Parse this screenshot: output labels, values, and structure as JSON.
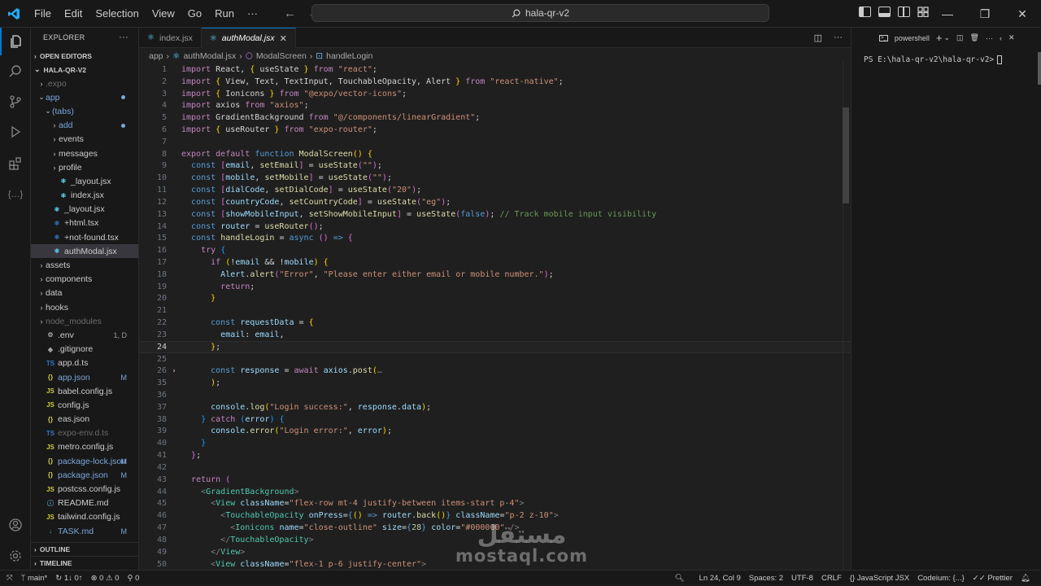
{
  "titlebar": {
    "menu": [
      "File",
      "Edit",
      "Selection",
      "View",
      "Go",
      "Run",
      "···"
    ],
    "search": "hala-qr-v2"
  },
  "sidebar": {
    "title": "EXPLORER",
    "more": "···",
    "open_editors": "OPEN EDITORS",
    "project": "HALA-QR-V2",
    "items": [
      {
        "label": ".expo",
        "type": "folder",
        "indent": 1,
        "state": "collapsed",
        "dim": true,
        "icon": "folder"
      },
      {
        "label": "app",
        "type": "folder",
        "indent": 1,
        "state": "expanded",
        "mod": true,
        "badge": "dot",
        "icon": "folder"
      },
      {
        "label": "(tabs)",
        "type": "folder",
        "indent": 2,
        "state": "expanded",
        "mod": true,
        "icon": "folder"
      },
      {
        "label": "add",
        "type": "folder",
        "indent": 3,
        "state": "collapsed",
        "mod": true,
        "badge": "dot",
        "icon": "folder"
      },
      {
        "label": "events",
        "type": "folder",
        "indent": 3,
        "state": "collapsed",
        "icon": "folder"
      },
      {
        "label": "messages",
        "type": "folder",
        "indent": 3,
        "state": "collapsed",
        "icon": "folder"
      },
      {
        "label": "profile",
        "type": "folder",
        "indent": 3,
        "state": "collapsed",
        "icon": "folder"
      },
      {
        "label": "_layout.jsx",
        "type": "file",
        "indent": 3,
        "icon": "react",
        "icon_color": "#61dafb"
      },
      {
        "label": "index.jsx",
        "type": "file",
        "indent": 3,
        "icon": "react",
        "icon_color": "#61dafb"
      },
      {
        "label": "_layout.jsx",
        "type": "file",
        "indent": 2,
        "icon": "react",
        "icon_color": "#61dafb"
      },
      {
        "label": "+html.tsx",
        "type": "file",
        "indent": 2,
        "icon": "react-ts",
        "icon_color": "#3178c6"
      },
      {
        "label": "+not-found.tsx",
        "type": "file",
        "indent": 2,
        "icon": "react-ts",
        "icon_color": "#3178c6"
      },
      {
        "label": "authModal.jsx",
        "type": "file",
        "indent": 2,
        "icon": "react",
        "icon_color": "#61dafb",
        "selected": true
      },
      {
        "label": "assets",
        "type": "folder",
        "indent": 1,
        "state": "collapsed",
        "icon": "folder"
      },
      {
        "label": "components",
        "type": "folder",
        "indent": 1,
        "state": "collapsed",
        "icon": "folder"
      },
      {
        "label": "data",
        "type": "folder",
        "indent": 1,
        "state": "collapsed",
        "icon": "folder"
      },
      {
        "label": "hooks",
        "type": "folder",
        "indent": 1,
        "state": "collapsed",
        "icon": "folder"
      },
      {
        "label": "node_modules",
        "type": "folder",
        "indent": 1,
        "state": "collapsed",
        "dim": true,
        "icon": "folder"
      },
      {
        "label": ".env",
        "type": "file",
        "indent": 1,
        "icon": "gear",
        "icon_color": "#a0a0a0",
        "badge_text": "1, D",
        "badge_gray": true
      },
      {
        "label": ".gitignore",
        "type": "file",
        "indent": 1,
        "icon": "git",
        "icon_color": "#a0a0a0"
      },
      {
        "label": "app.d.ts",
        "type": "file",
        "indent": 1,
        "icon": "TS",
        "icon_color": "#3178c6"
      },
      {
        "label": "app.json",
        "type": "file",
        "indent": 1,
        "icon": "{}",
        "icon_color": "#cbcb41",
        "mod": true,
        "badge_text": "M"
      },
      {
        "label": "babel.config.js",
        "type": "file",
        "indent": 1,
        "icon": "JS",
        "icon_color": "#cbcb41"
      },
      {
        "label": "config.js",
        "type": "file",
        "indent": 1,
        "icon": "JS",
        "icon_color": "#cbcb41"
      },
      {
        "label": "eas.json",
        "type": "file",
        "indent": 1,
        "icon": "{}",
        "icon_color": "#cbcb41"
      },
      {
        "label": "expo-env.d.ts",
        "type": "file",
        "indent": 1,
        "icon": "TS",
        "icon_color": "#3178c6",
        "dim": true
      },
      {
        "label": "metro.config.js",
        "type": "file",
        "indent": 1,
        "icon": "JS",
        "icon_color": "#cbcb41"
      },
      {
        "label": "package-lock.json",
        "type": "file",
        "indent": 1,
        "icon": "{}",
        "icon_color": "#cbcb41",
        "mod": true,
        "badge_text": "M"
      },
      {
        "label": "package.json",
        "type": "file",
        "indent": 1,
        "icon": "{}",
        "icon_color": "#cbcb41",
        "mod": true,
        "badge_text": "M"
      },
      {
        "label": "postcss.config.js",
        "type": "file",
        "indent": 1,
        "icon": "JS",
        "icon_color": "#cbcb41"
      },
      {
        "label": "README.md",
        "type": "file",
        "indent": 1,
        "icon": "info",
        "icon_color": "#519aba"
      },
      {
        "label": "tailwind.config.js",
        "type": "file",
        "indent": 1,
        "icon": "JS",
        "icon_color": "#cbcb41"
      },
      {
        "label": "TASK.md",
        "type": "file",
        "indent": 1,
        "icon": "md",
        "icon_color": "#519aba",
        "mod": true,
        "badge_text": "M"
      }
    ],
    "outline": "OUTLINE",
    "timeline": "TIMELINE"
  },
  "tabs": [
    {
      "label": "index.jsx",
      "active": false
    },
    {
      "label": "authModal.jsx",
      "active": true,
      "close": "✕"
    }
  ],
  "breadcrumb": {
    "parts": [
      "app",
      "authModal.jsx",
      "ModalScreen",
      "handleLogin"
    ],
    "sep": "›"
  },
  "editor": {
    "current_line": 24,
    "lines": [
      {
        "n": 1,
        "html": "<span class='k'>import</span> React, <span class='b1'>{</span> useState <span class='b1'>}</span> <span class='k'>from</span> <span class='s'>\"react\"</span>;"
      },
      {
        "n": 2,
        "html": "<span class='k'>import</span> <span class='b1'>{</span> View, Text, TextInput, TouchableOpacity, Alert <span class='b1'>}</span> <span class='k'>from</span> <span class='s'>\"react-native\"</span>;"
      },
      {
        "n": 3,
        "html": "<span class='k'>import</span> <span class='b1'>{</span> Ionicons <span class='b1'>}</span> <span class='k'>from</span> <span class='s'>\"@expo/vector-icons\"</span>;"
      },
      {
        "n": 4,
        "html": "<span class='k'>import</span> axios <span class='k'>from</span> <span class='s'>\"axios\"</span>;"
      },
      {
        "n": 5,
        "html": "<span class='k'>import</span> GradientBackground <span class='k'>from</span> <span class='s'>\"@/components/linearGradient\"</span>;"
      },
      {
        "n": 6,
        "html": "<span class='k'>import</span> <span class='b1'>{</span> useRouter <span class='b1'>}</span> <span class='k'>from</span> <span class='s'>\"expo-router\"</span>;"
      },
      {
        "n": 7,
        "html": ""
      },
      {
        "n": 8,
        "html": "<span class='k'>export</span> <span class='k'>default</span> <span class='kb'>function</span> <span class='f'>ModalScreen</span><span class='b1'>()</span> <span class='b1'>{</span>"
      },
      {
        "n": 9,
        "html": "  <span class='kb'>const</span> <span class='b2'>[</span><span class='v'>email</span>, <span class='f'>setEmail</span><span class='b2'>]</span> = <span class='f'>useState</span><span class='b2'>(</span><span class='s'>\"\"</span><span class='b2'>)</span>;"
      },
      {
        "n": 10,
        "html": "  <span class='kb'>const</span> <span class='b2'>[</span><span class='v'>mobile</span>, <span class='f'>setMobile</span><span class='b2'>]</span> = <span class='f'>useState</span><span class='b2'>(</span><span class='s'>\"\"</span><span class='b2'>)</span>;"
      },
      {
        "n": 11,
        "html": "  <span class='kb'>const</span> <span class='b2'>[</span><span class='v'>dialCode</span>, <span class='f'>setDialCode</span><span class='b2'>]</span> = <span class='f'>useState</span><span class='b2'>(</span><span class='s'>\"20\"</span><span class='b2'>)</span>;"
      },
      {
        "n": 12,
        "html": "  <span class='kb'>const</span> <span class='b2'>[</span><span class='v'>countryCode</span>, <span class='f'>setCountryCode</span><span class='b2'>]</span> = <span class='f'>useState</span><span class='b2'>(</span><span class='s'>\"eg\"</span><span class='b2'>)</span>;"
      },
      {
        "n": 13,
        "html": "  <span class='kb'>const</span> <span class='b2'>[</span><span class='v'>showMobileInput</span>, <span class='f'>setShowMobileInput</span><span class='b2'>]</span> = <span class='f'>useState</span><span class='b2'>(</span><span class='kb'>false</span><span class='b2'>)</span>; <span class='c'>// Track mobile input visibility</span>"
      },
      {
        "n": 14,
        "html": "  <span class='kb'>const</span> <span class='v'>router</span> = <span class='f'>useRouter</span><span class='b2'>()</span>;"
      },
      {
        "n": 15,
        "html": "  <span class='kb'>const</span> <span class='f'>handleLogin</span> = <span class='kb'>async</span> <span class='b2'>()</span> <span class='kb'>=&gt;</span> <span class='b2'>{</span>"
      },
      {
        "n": 16,
        "html": "    <span class='k'>try</span> <span class='b3'>{</span>"
      },
      {
        "n": 17,
        "html": "      <span class='k'>if</span> <span class='b1'>(</span>!<span class='v'>email</span> &amp;&amp; !<span class='v'>mobile</span><span class='b1'>)</span> <span class='b1'>{</span>"
      },
      {
        "n": 18,
        "html": "        <span class='v'>Alert</span>.<span class='f'>alert</span><span class='b2'>(</span><span class='s'>\"Error\"</span>, <span class='s'>\"Please enter either email or mobile number.\"</span><span class='b2'>)</span>;"
      },
      {
        "n": 19,
        "html": "        <span class='k'>return</span>;"
      },
      {
        "n": 20,
        "html": "      <span class='b1'>}</span>"
      },
      {
        "n": 21,
        "html": ""
      },
      {
        "n": 22,
        "html": "      <span class='kb'>const</span> <span class='v'>requestData</span> = <span class='b1'>{</span>"
      },
      {
        "n": 23,
        "html": "        <span class='v'>email</span>: <span class='v'>email</span>,"
      },
      {
        "n": 24,
        "html": "      <span class='b1'>}</span>;"
      },
      {
        "n": 25,
        "html": ""
      },
      {
        "n": 26,
        "html": "      <span class='kb'>const</span> <span class='v'>response</span> = <span class='k'>await</span> <span class='v'>axios</span>.<span class='f'>post</span><span class='b1'>(</span><span class='gray'>…</span>",
        "folded": true
      },
      {
        "n": 35,
        "html": "      <span class='b1'>)</span>;"
      },
      {
        "n": 36,
        "html": ""
      },
      {
        "n": 37,
        "html": "      <span class='v'>console</span>.<span class='f'>log</span><span class='b1'>(</span><span class='s'>\"Login success:\"</span>, <span class='v'>response</span>.<span class='v'>data</span><span class='b1'>)</span>;"
      },
      {
        "n": 38,
        "html": "    <span class='b3'>}</span> <span class='k'>catch</span> <span class='b3'>(</span><span class='v'>error</span><span class='b3'>)</span> <span class='b3'>{</span>"
      },
      {
        "n": 39,
        "html": "      <span class='v'>console</span>.<span class='f'>error</span><span class='b1'>(</span><span class='s'>\"Login error:\"</span>, <span class='v'>error</span><span class='b1'>)</span>;"
      },
      {
        "n": 40,
        "html": "    <span class='b3'>}</span>"
      },
      {
        "n": 41,
        "html": "  <span class='b2'>}</span>;"
      },
      {
        "n": 42,
        "html": ""
      },
      {
        "n": 43,
        "html": "  <span class='k'>return</span> <span class='b2'>(</span>"
      },
      {
        "n": 44,
        "html": "    <span class='gray'>&lt;</span><span class='tag'>GradientBackground</span><span class='gray'>&gt;</span>"
      },
      {
        "n": 45,
        "html": "      <span class='gray'>&lt;</span><span class='tag'>View</span> <span class='attr'>className</span>=<span class='s'>\"flex-row mt-4 justify-between items-start p-4\"</span><span class='gray'>&gt;</span>"
      },
      {
        "n": 46,
        "html": "        <span class='gray'>&lt;</span><span class='tag'>TouchableOpacity</span> <span class='attr'>onPress</span>=<span class='kb'>{</span><span class='b1'>()</span> <span class='kb'>=&gt;</span> <span class='v'>router</span>.<span class='f'>back</span><span class='b1'>()</span><span class='kb'>}</span> <span class='attr'>className</span>=<span class='s'>\"p-2 z-10\"</span><span class='gray'>&gt;</span>"
      },
      {
        "n": 47,
        "html": "          <span class='gray'>&lt;</span><span class='tag'>Ionicons</span> <span class='attr'>name</span>=<span class='s'>\"close-outline\"</span> <span class='attr'>size</span>=<span class='kb'>{</span><span class='n'>28</span><span class='kb'>}</span> <span class='attr'>color</span>=<span class='s'>\"#000000\"</span> <span class='gray'>/&gt;</span>"
      },
      {
        "n": 48,
        "html": "        <span class='gray'>&lt;/</span><span class='tag'>TouchableOpacity</span><span class='gray'>&gt;</span>"
      },
      {
        "n": 49,
        "html": "      <span class='gray'>&lt;/</span><span class='tag'>View</span><span class='gray'>&gt;</span>"
      },
      {
        "n": 50,
        "html": "      <span class='gray'>&lt;</span><span class='tag'>View</span> <span class='attr'>className</span>=<span class='s'>\"flex-1 p-6 justify-center\"</span><span class='gray'>&gt;</span>"
      }
    ]
  },
  "panel": {
    "terminal_label": "powershell",
    "prompt": "PS E:\\hala-qr-v2\\hala-qr-v2>"
  },
  "statusbar": {
    "branch": "main*",
    "sync": "↻ 1↓ 0↑",
    "problems": "⊗ 0 ⚠ 0",
    "ports": "⚲ 0",
    "position": "Ln 24, Col 9",
    "spaces": "Spaces: 2",
    "encoding": "UTF-8",
    "eol": "CRLF",
    "language": "JavaScript JSX",
    "codeium": "Codeium: {...}",
    "prettier": "Prettier"
  },
  "watermark": {
    "arabic": "مستقل",
    "latin": "mostaql.com"
  }
}
